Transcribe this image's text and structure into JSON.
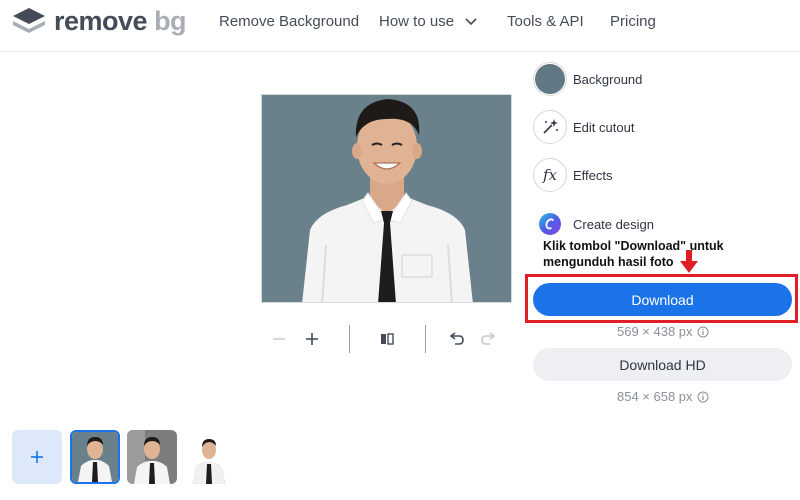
{
  "brand": {
    "word1": "remove",
    "word2": "bg"
  },
  "nav": {
    "remove_background": "Remove Background",
    "how_to_use": "How to use",
    "tools_api": "Tools & API",
    "pricing": "Pricing"
  },
  "options": {
    "background": "Background",
    "edit_cutout": "Edit cutout",
    "effects": "Effects",
    "create_design": "Create design"
  },
  "annotation": {
    "line1": "Klik tombol \"Download\" untuk",
    "line2": "mengunduh hasil foto"
  },
  "download": {
    "label": "Download",
    "dimensions": "569 × 438 px"
  },
  "download_hd": {
    "label": "Download HD",
    "dimensions": "854 × 658 px"
  },
  "icons": {
    "logo": "removebg-logo-icon",
    "chevron": "chevron-down-icon",
    "zoom_out": "minus-icon",
    "zoom_in": "plus-icon",
    "compare": "compare-icon",
    "undo": "undo-icon",
    "redo": "redo-icon",
    "edit_cutout": "magic-wand-icon",
    "effects": "fx-icon",
    "create_design": "canva-icon",
    "info": "info-icon",
    "add": "plus-icon",
    "arrow": "arrow-down-icon"
  },
  "colors": {
    "primary": "#1a73e8",
    "background_swatch": "#607784",
    "highlight": "#e01e25",
    "secondary_button": "#edeff2"
  }
}
